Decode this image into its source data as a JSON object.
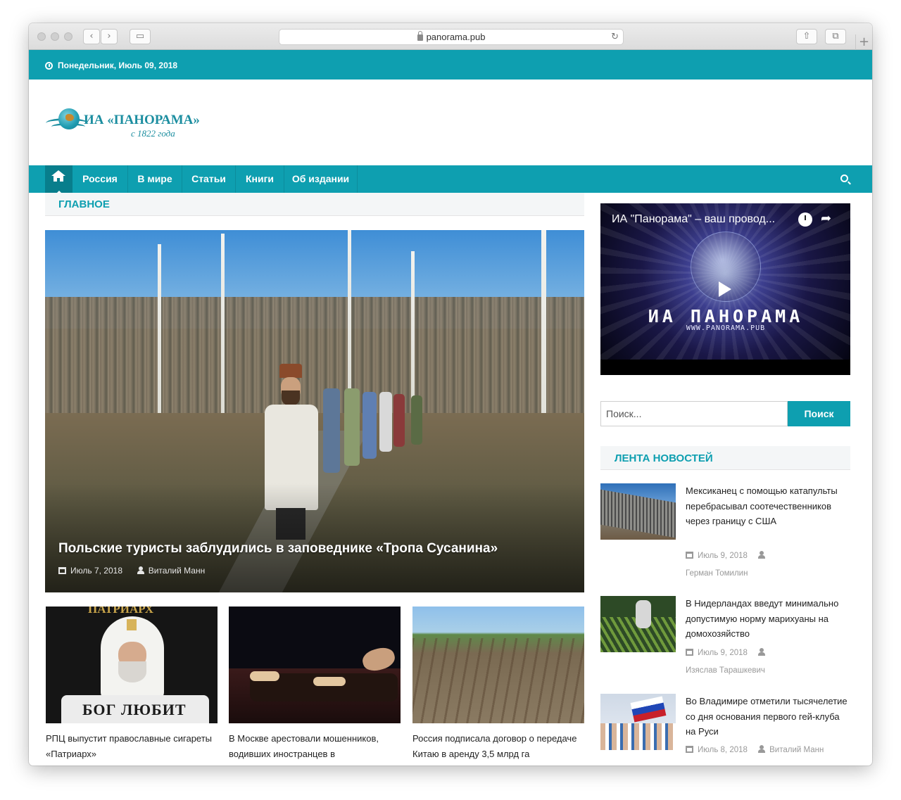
{
  "browser": {
    "url": "panorama.pub"
  },
  "topbar": {
    "date": "Понедельник, Июль 09, 2018"
  },
  "logo": {
    "name": "ИА «ПАНОРАМА»",
    "since": "с 1822 года"
  },
  "nav": {
    "items": [
      "Россия",
      "В мире",
      "Статьи",
      "Книги",
      "Об издании"
    ]
  },
  "main": {
    "section_title": "ГЛАВНОЕ",
    "featured": {
      "title": "Польские туристы заблудились в заповеднике «Тропа Сусанина»",
      "date": "Июль 7, 2018",
      "author": "Виталий Манн"
    },
    "cards": [
      {
        "caption": "РПЦ выпустит православные сигареты «Патриарх»",
        "image_text_top": "ПАТРИАРХ",
        "image_text_pack": "БОГ ЛЮБИТ"
      },
      {
        "caption": "В Москве арестовали мошенников, водивших иностранцев в"
      },
      {
        "caption": "Россия подписала договор о передаче Китаю в аренду 3,5 млрд га"
      }
    ]
  },
  "sidebar": {
    "video": {
      "title": "ИА \"Панорама\" – ваш провод...",
      "brand": "ИА ПАНОРАМА",
      "url": "WWW.PANORAMA.PUB"
    },
    "search": {
      "placeholder": "Поиск...",
      "button": "Поиск"
    },
    "news_title": "ЛЕНТА НОВОСТЕЙ",
    "news": [
      {
        "title": "Мексиканец с помощью катапульты перебрасывал соотечественников через границу с США",
        "date": "Июль 9, 2018",
        "author": "Герман Томилин"
      },
      {
        "title": "В Нидерландах введут минимально допустимую норму марихуаны на домохозяйство",
        "date": "Июль 9, 2018",
        "author": "Изяслав Тарашкевич"
      },
      {
        "title": "Во Владимире отметили тысячелетие со дня основания первого гей-клуба на Руси",
        "date": "Июль 8, 2018",
        "author": "Виталий Манн"
      }
    ]
  },
  "colors": {
    "accent": "#0e9fb0",
    "accent_dark": "#087e8c"
  }
}
